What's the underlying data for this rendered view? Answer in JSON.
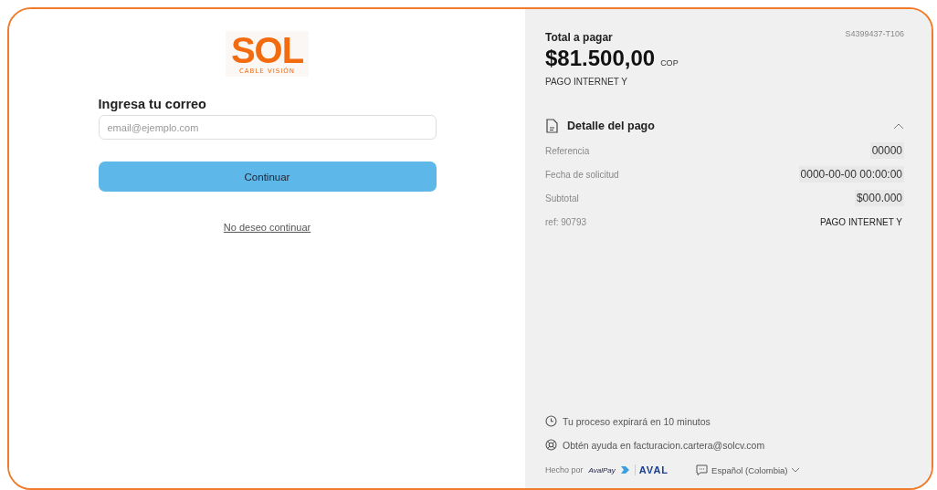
{
  "logo": {
    "name": "SOL",
    "tagline": "CABLE VISIÓN"
  },
  "login": {
    "heading": "Ingresa tu correo",
    "email": {
      "placeholder": "email@ejemplo.com"
    },
    "continue_button": "Continuar",
    "cancel_link": "No deseo continuar"
  },
  "summary": {
    "total_label": "Total a pagar",
    "order_id": "S4399437-T106",
    "amount": "$81.500,00",
    "currency": "COP",
    "description": "PAGO INTERNET Y"
  },
  "details": {
    "title": "Detalle del pago",
    "expanded": true,
    "rows": [
      {
        "label": "Referencia",
        "value": "00000"
      },
      {
        "label": "Fecha de solicitud",
        "value": "0000-00-00 00:00:00"
      },
      {
        "label": "Subtotal",
        "value": "$000.000"
      },
      {
        "label": "ref: 90793",
        "value": "PAGO INTERNET Y"
      }
    ]
  },
  "info": [
    {
      "kind": "clock",
      "text": "Tu proceso expirará en 10 minutos"
    },
    {
      "kind": "help",
      "text": "Obtén ayuda en facturacion.cartera@solcv.com"
    }
  ],
  "footer": {
    "made_by": "Hecho por",
    "brand_small": "AvalPay",
    "brand": "AVAL",
    "language": "Español (Colombia)"
  }
}
